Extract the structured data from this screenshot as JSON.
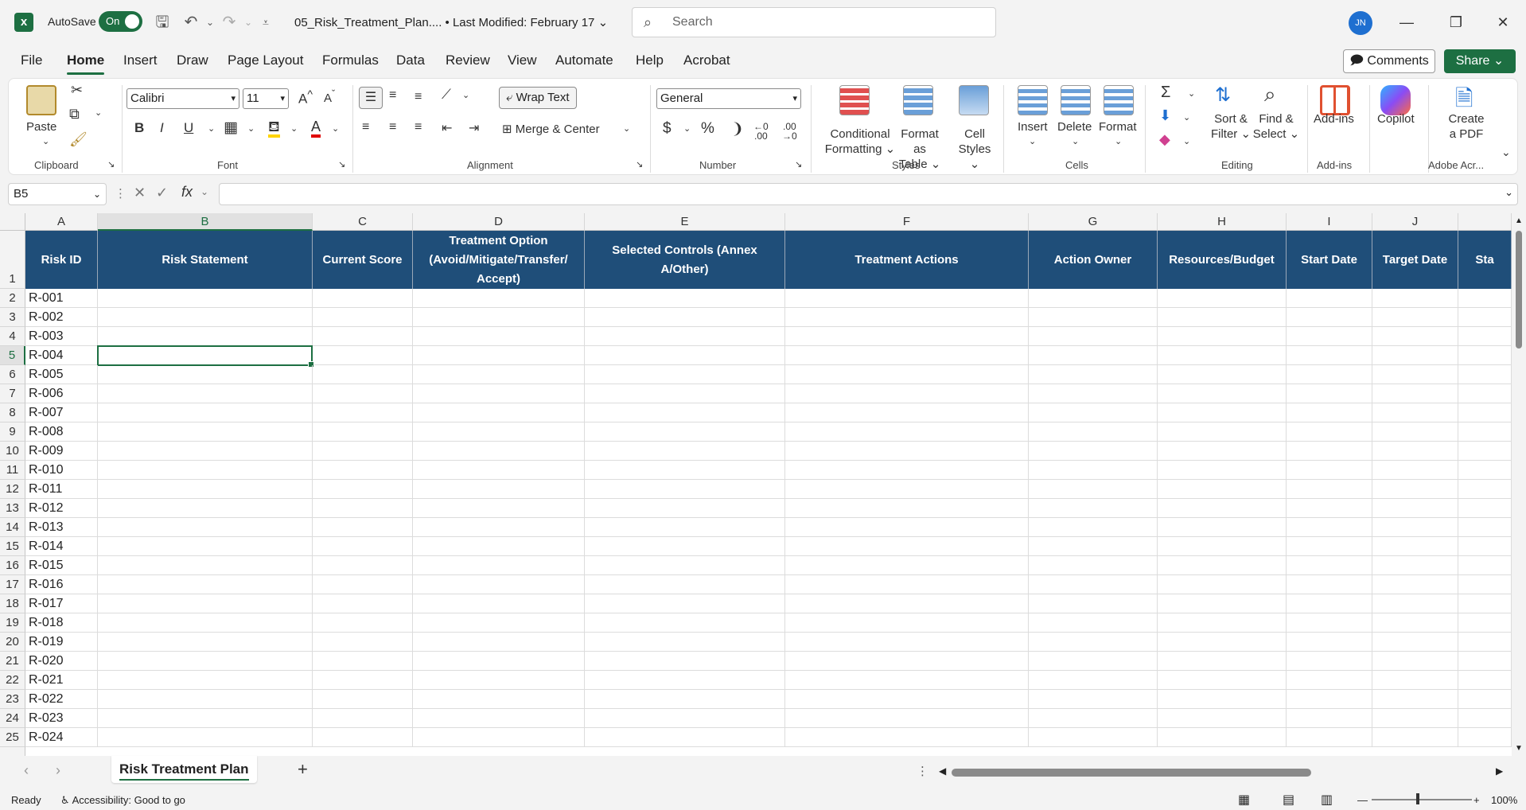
{
  "app": {
    "autosave_label": "AutoSave",
    "autosave_state": "On",
    "document_title": "05_Risk_Treatment_Plan.... • Last Modified: February 17",
    "search_placeholder": "Search",
    "user_initials": "JN"
  },
  "tabs": [
    "File",
    "Home",
    "Insert",
    "Draw",
    "Page Layout",
    "Formulas",
    "Data",
    "Review",
    "View",
    "Automate",
    "Help",
    "Acrobat"
  ],
  "header_buttons": {
    "comments": "Comments",
    "share": "Share"
  },
  "ribbon": {
    "clipboard": {
      "paste": "Paste",
      "label": "Clipboard"
    },
    "font": {
      "name": "Calibri",
      "size": "11",
      "label": "Font",
      "bold": "B",
      "italic": "I",
      "underline": "U",
      "font_color": "A"
    },
    "alignment": {
      "wrap_text": "Wrap Text",
      "merge_center": "Merge & Center",
      "label": "Alignment"
    },
    "number": {
      "format": "General",
      "currency": "$",
      "percent": "%",
      "comma": "❩",
      "label": "Number"
    },
    "styles": {
      "conditional_formatting_1": "Conditional",
      "conditional_formatting_2": "Formatting",
      "format_as_table_1": "Format as",
      "format_as_table_2": "Table",
      "cell_styles_1": "Cell",
      "cell_styles_2": "Styles",
      "label": "Styles"
    },
    "cells": {
      "insert": "Insert",
      "delete": "Delete",
      "format": "Format",
      "label": "Cells"
    },
    "editing": {
      "sort_filter_1": "Sort &",
      "sort_filter_2": "Filter",
      "find_select_1": "Find &",
      "find_select_2": "Select",
      "label": "Editing"
    },
    "addins": {
      "addins": "Add-ins",
      "label": "Add-ins"
    },
    "copilot": {
      "label": "Copilot"
    },
    "adobe": {
      "create_pdf_1": "Create",
      "create_pdf_2": "a PDF",
      "label": "Adobe Acr..."
    }
  },
  "formula_bar": {
    "name_box": "B5",
    "fx": "fx",
    "value": ""
  },
  "columns": [
    "A",
    "B",
    "C",
    "D",
    "E",
    "F",
    "G",
    "H",
    "I",
    "J"
  ],
  "header_row": [
    "Risk ID",
    "Risk Statement",
    "Current Score",
    "Treatment Option (Avoid/Mitigate/Transfer/ Accept)",
    "Selected Controls (Annex A/Other)",
    "Treatment Actions",
    "Action Owner",
    "Resources/Budget",
    "Start Date",
    "Target Date",
    "Sta"
  ],
  "rows": [
    {
      "num": "1",
      "id": ""
    },
    {
      "num": "2",
      "id": "R-001"
    },
    {
      "num": "3",
      "id": "R-002"
    },
    {
      "num": "4",
      "id": "R-003"
    },
    {
      "num": "5",
      "id": "R-004"
    },
    {
      "num": "6",
      "id": "R-005"
    },
    {
      "num": "7",
      "id": "R-006"
    },
    {
      "num": "8",
      "id": "R-007"
    },
    {
      "num": "9",
      "id": "R-008"
    },
    {
      "num": "10",
      "id": "R-009"
    },
    {
      "num": "11",
      "id": "R-010"
    },
    {
      "num": "12",
      "id": "R-011"
    },
    {
      "num": "13",
      "id": "R-012"
    },
    {
      "num": "14",
      "id": "R-013"
    },
    {
      "num": "15",
      "id": "R-014"
    },
    {
      "num": "16",
      "id": "R-015"
    },
    {
      "num": "17",
      "id": "R-016"
    },
    {
      "num": "18",
      "id": "R-017"
    },
    {
      "num": "19",
      "id": "R-018"
    },
    {
      "num": "20",
      "id": "R-019"
    },
    {
      "num": "21",
      "id": "R-020"
    },
    {
      "num": "22",
      "id": "R-021"
    },
    {
      "num": "23",
      "id": "R-022"
    },
    {
      "num": "24",
      "id": "R-023"
    },
    {
      "num": "25",
      "id": "R-024"
    }
  ],
  "sheet": {
    "name": "Risk Treatment Plan",
    "add": "+"
  },
  "status": {
    "ready": "Ready",
    "accessibility": "Accessibility: Good to go",
    "zoom": "100%"
  }
}
